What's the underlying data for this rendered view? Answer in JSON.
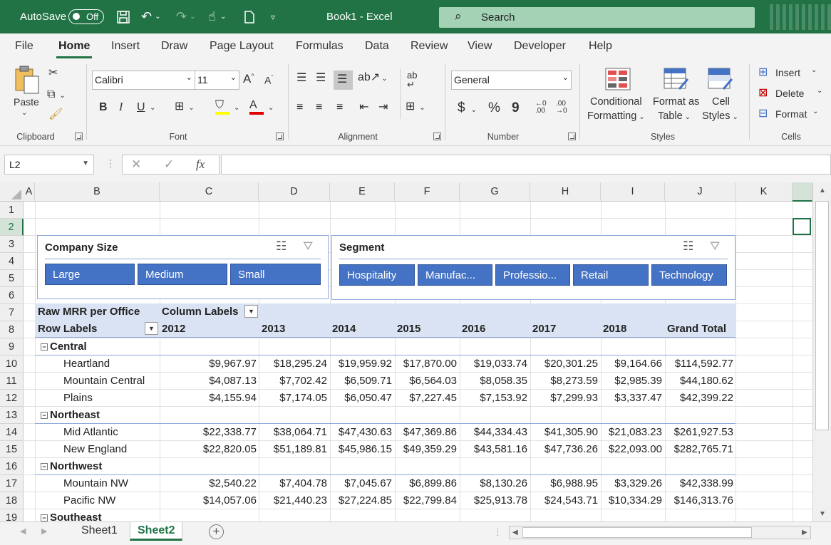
{
  "titlebar": {
    "autosave_label": "AutoSave",
    "autosave_state": "Off",
    "title": "Book1  -  Excel",
    "search_placeholder": "Search"
  },
  "tabs": [
    "File",
    "Home",
    "Insert",
    "Draw",
    "Page Layout",
    "Formulas",
    "Data",
    "Review",
    "View",
    "Developer",
    "Help"
  ],
  "active_tab": "Home",
  "ribbon": {
    "clipboard": {
      "paste": "Paste",
      "label": "Clipboard"
    },
    "font": {
      "name": "Calibri",
      "size": "11",
      "label": "Font",
      "bold": "B",
      "italic": "I",
      "underline": "U"
    },
    "alignment": {
      "label": "Alignment"
    },
    "number": {
      "format": "General",
      "label": "Number",
      "currency": "$",
      "percent": "%",
      "comma": "9"
    },
    "styles": {
      "conditional_1": "Conditional",
      "conditional_2": "Formatting",
      "format_table_1": "Format as",
      "format_table_2": "Table",
      "cell_styles_1": "Cell",
      "cell_styles_2": "Styles",
      "label": "Styles"
    },
    "cells": {
      "insert": "Insert",
      "delete": "Delete",
      "format": "Format",
      "label": "Cells"
    }
  },
  "formula_bar": {
    "name_box": "L2",
    "fx": "fx",
    "formula": ""
  },
  "columns": [
    "A",
    "B",
    "C",
    "D",
    "E",
    "F",
    "G",
    "H",
    "I",
    "J",
    "K"
  ],
  "rows": [
    "1",
    "2",
    "3",
    "4",
    "5",
    "6",
    "7",
    "8",
    "9",
    "10",
    "11",
    "12",
    "13",
    "14",
    "15",
    "16",
    "17",
    "18",
    "19"
  ],
  "selected_row": "2",
  "slicers": {
    "company_size": {
      "title": "Company Size",
      "items": [
        "Large",
        "Medium",
        "Small"
      ]
    },
    "segment": {
      "title": "Segment",
      "items": [
        "Hospitality",
        "Manufac...",
        "Professio...",
        "Retail",
        "Technology"
      ]
    }
  },
  "pivot": {
    "values_label": "Raw MRR per Office",
    "column_labels": "Column Labels",
    "row_labels": "Row Labels",
    "years": [
      "2012",
      "2013",
      "2014",
      "2015",
      "2016",
      "2017",
      "2018"
    ],
    "grand_total": "Grand Total",
    "groups": [
      {
        "name": "Central",
        "rows": [
          {
            "label": "Heartland",
            "values": [
              "$9,967.97",
              "$18,295.24",
              "$19,959.92",
              "$17,870.00",
              "$19,033.74",
              "$20,301.25",
              "$9,164.66",
              "$114,592.77"
            ]
          },
          {
            "label": "Mountain Central",
            "values": [
              "$4,087.13",
              "$7,702.42",
              "$6,509.71",
              "$6,564.03",
              "$8,058.35",
              "$8,273.59",
              "$2,985.39",
              "$44,180.62"
            ]
          },
          {
            "label": "Plains",
            "values": [
              "$4,155.94",
              "$7,174.05",
              "$6,050.47",
              "$7,227.45",
              "$7,153.92",
              "$7,299.93",
              "$3,337.47",
              "$42,399.22"
            ]
          }
        ]
      },
      {
        "name": "Northeast",
        "rows": [
          {
            "label": "Mid Atlantic",
            "values": [
              "$22,338.77",
              "$38,064.71",
              "$47,430.63",
              "$47,369.86",
              "$44,334.43",
              "$41,305.90",
              "$21,083.23",
              "$261,927.53"
            ]
          },
          {
            "label": "New England",
            "values": [
              "$22,820.05",
              "$51,189.81",
              "$45,986.15",
              "$49,359.29",
              "$43,581.16",
              "$47,736.26",
              "$22,093.00",
              "$282,765.71"
            ]
          }
        ]
      },
      {
        "name": "Northwest",
        "rows": [
          {
            "label": "Mountain NW",
            "values": [
              "$2,540.22",
              "$7,404.78",
              "$7,045.67",
              "$6,899.86",
              "$8,130.26",
              "$6,988.95",
              "$3,329.26",
              "$42,338.99"
            ]
          },
          {
            "label": "Pacific NW",
            "values": [
              "$14,057.06",
              "$21,440.23",
              "$27,224.85",
              "$22,799.84",
              "$25,913.78",
              "$24,543.71",
              "$10,334.29",
              "$146,313.76"
            ]
          }
        ]
      },
      {
        "name": "Southeast",
        "rows": []
      }
    ]
  },
  "sheets": [
    "Sheet1",
    "Sheet2"
  ],
  "active_sheet": "Sheet2"
}
